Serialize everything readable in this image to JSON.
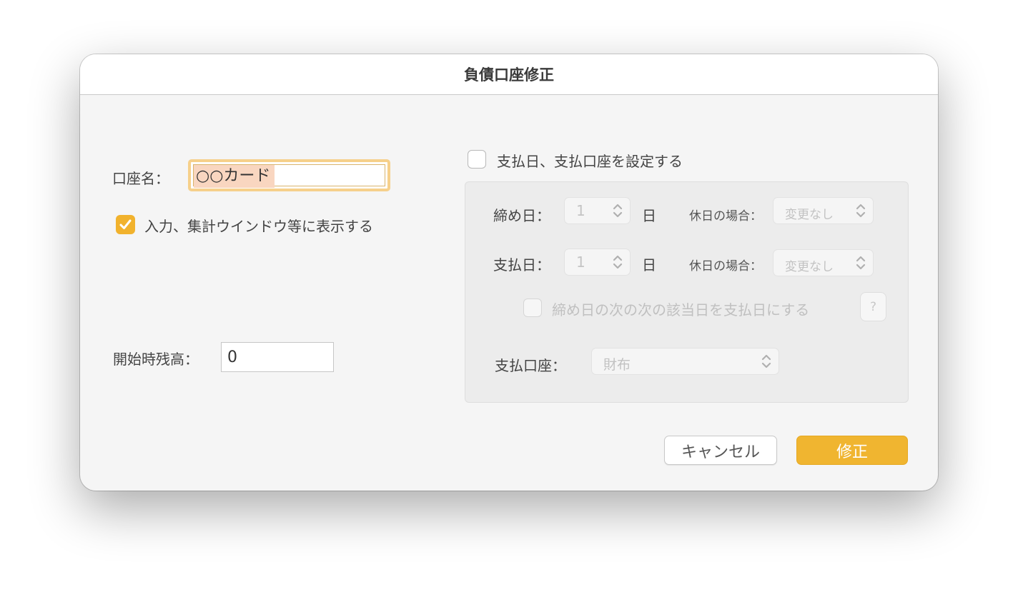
{
  "dialog": {
    "title": "負債口座修正"
  },
  "left": {
    "account_name_label": "口座名：",
    "account_name_value": "○○カード",
    "show_in_windows_label": "入力、集計ウインドウ等に表示する",
    "show_in_windows_checked": true,
    "opening_balance_label": "開始時残高：",
    "opening_balance_value": "0"
  },
  "payment": {
    "enable_label": "支払日、支払口座を設定する",
    "enable_checked": false,
    "closing_day_label": "締め日：",
    "closing_day_value": "1",
    "closing_day_unit": "日",
    "closing_holiday_label": "休日の場合：",
    "closing_holiday_value": "変更なし",
    "payment_day_label": "支払日：",
    "payment_day_value": "1",
    "payment_day_unit": "日",
    "payment_holiday_label": "休日の場合：",
    "payment_holiday_value": "変更なし",
    "next_next_label": "締め日の次の次の該当日を支払日にする",
    "next_next_checked": false,
    "help_label": "?",
    "account_label": "支払口座：",
    "account_value": "財布"
  },
  "buttons": {
    "cancel_label": "キャンセル",
    "ok_label": "修正"
  },
  "colors": {
    "accent": "#f0b530",
    "focus_ring": "#f6d08b",
    "selection": "#f9d6c0"
  }
}
